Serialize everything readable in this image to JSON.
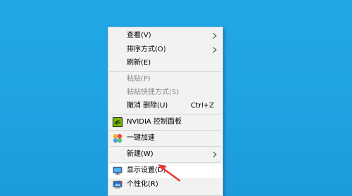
{
  "context_menu": {
    "view": "查看(V)",
    "sort_by": "排序方式(O)",
    "refresh": "刷新(E)",
    "paste": "粘贴(P)",
    "paste_shortcut": "粘贴快捷方式(S)",
    "undo_delete": "撤消 删除(U)",
    "undo_shortcut": "Ctrl+Z",
    "nvidia_control_panel": "NVIDIA 控制面板",
    "one_click_acceleration": "一键加速",
    "new": "新建(W)",
    "display_settings": "显示设置(D)",
    "personalize": "个性化(R)"
  },
  "icons": {
    "nvidia": "nvidia-icon",
    "acceleration": "acceleration-icon",
    "display": "display-icon",
    "personalize": "personalize-icon",
    "pointer": "red-arrow-annotation"
  },
  "colors": {
    "desktop_blue": "#1fa3e3",
    "menu_bg": "#f2f2f2",
    "disabled_text": "#8d8d8d",
    "arrow_red": "#e53935"
  }
}
